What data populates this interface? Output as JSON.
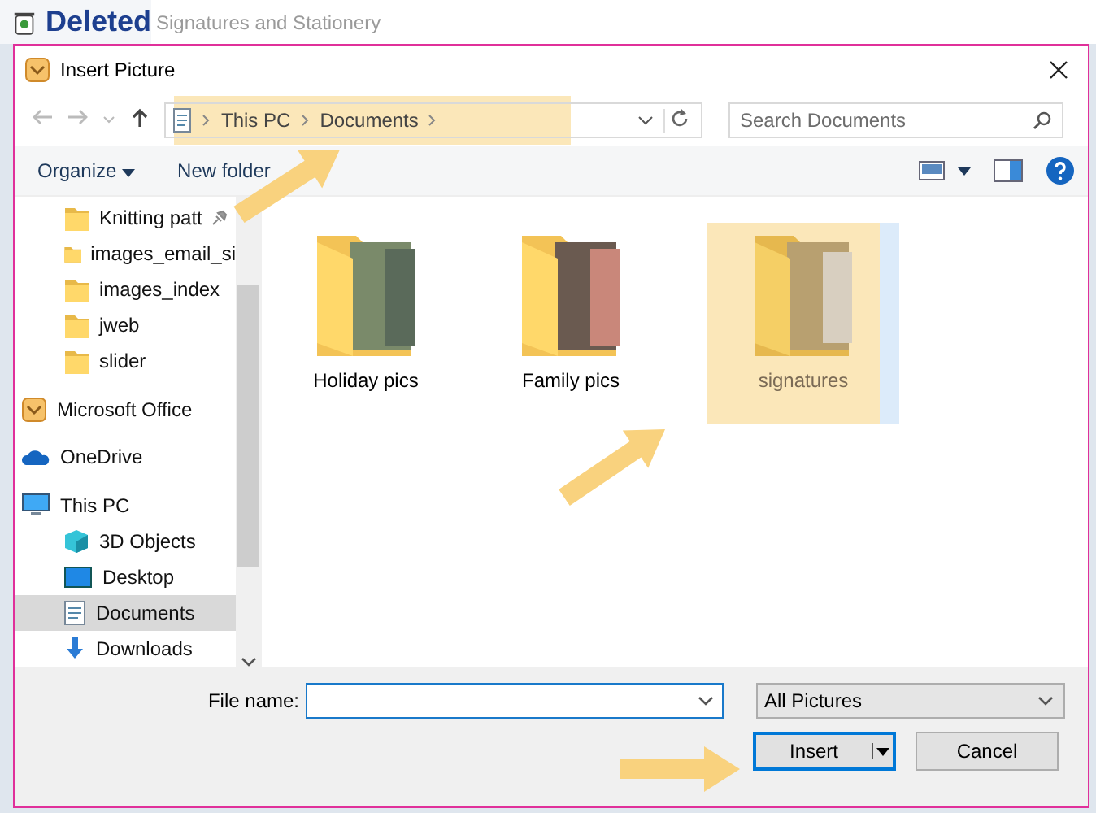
{
  "background": {
    "heading": "Deleted",
    "window_title": "Signatures and Stationery"
  },
  "dialog": {
    "title": "Insert Picture"
  },
  "nav": {
    "breadcrumb": [
      "This PC",
      "Documents"
    ],
    "search": {
      "placeholder": "Search Documents"
    }
  },
  "toolbar": {
    "buttons": [
      "Organize",
      "New folder"
    ]
  },
  "sidebar": {
    "quick_access": [
      {
        "label": "Knitting patt",
        "pinned": true,
        "selected": false
      },
      {
        "label": "images_email_si",
        "pinned": false,
        "selected": false
      },
      {
        "label": "images_index",
        "pinned": false,
        "selected": false
      },
      {
        "label": "jweb",
        "pinned": false,
        "selected": false
      },
      {
        "label": "slider",
        "pinned": false,
        "selected": false
      }
    ],
    "items": [
      {
        "kind": "app",
        "label": "Microsoft Office",
        "selected": false
      },
      {
        "kind": "cloud",
        "label": "OneDrive",
        "selected": false
      },
      {
        "kind": "pc",
        "label": "This PC",
        "selected": false,
        "children": [
          {
            "kind": "objects3d",
            "label": "3D Objects",
            "selected": false
          },
          {
            "kind": "desktop",
            "label": "Desktop",
            "selected": false
          },
          {
            "kind": "documents",
            "label": "Documents",
            "selected": true
          },
          {
            "kind": "downloads",
            "label": "Downloads",
            "selected": false
          }
        ]
      }
    ]
  },
  "files": [
    {
      "kind": "photo_folder",
      "label": "Holiday pics",
      "selected": false
    },
    {
      "kind": "photo_folder",
      "label": "Family pics",
      "selected": false
    },
    {
      "kind": "text_folder",
      "label": "signatures",
      "selected": true
    }
  ],
  "footer": {
    "file_name_label": "File name:",
    "file_type": "All Pictures",
    "buttons": [
      {
        "kind": "split",
        "label": "Insert",
        "default": true
      },
      {
        "kind": "plain",
        "label": "Cancel",
        "default": false
      }
    ]
  }
}
